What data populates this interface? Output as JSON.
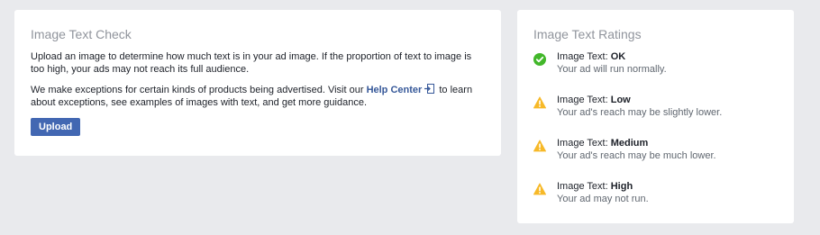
{
  "colors": {
    "page_background": "#e9eaed",
    "card_background": "#ffffff",
    "link": "#365899",
    "button": "#4267b2",
    "ok_green": "#42b72a",
    "warning_yellow": "#f7b928"
  },
  "check": {
    "title": "Image Text Check",
    "paragraph1": "Upload an image to determine how much text is in your ad image. If the proportion of text to image is too high, your ads may not reach its full audience.",
    "paragraph2_before": "We make exceptions for certain kinds of products being advertised. Visit our ",
    "help_link": "Help Center",
    "help_link_icon": "external-link-icon",
    "paragraph2_after": " to learn about exceptions, see examples of images with text, and get more guidance.",
    "upload_label": "Upload"
  },
  "ratings": {
    "title": "Image Text Ratings",
    "items": [
      {
        "prefix": "Image Text: ",
        "level": "OK",
        "description": "Your ad will run normally.",
        "icon": "check-circle-icon"
      },
      {
        "prefix": "Image Text: ",
        "level": "Low",
        "description": "Your ad's reach may be slightly lower.",
        "icon": "warning-icon"
      },
      {
        "prefix": "Image Text: ",
        "level": "Medium",
        "description": "Your ad's reach may be much lower.",
        "icon": "warning-icon"
      },
      {
        "prefix": "Image Text: ",
        "level": "High",
        "description": "Your ad may not run.",
        "icon": "warning-icon"
      }
    ]
  }
}
